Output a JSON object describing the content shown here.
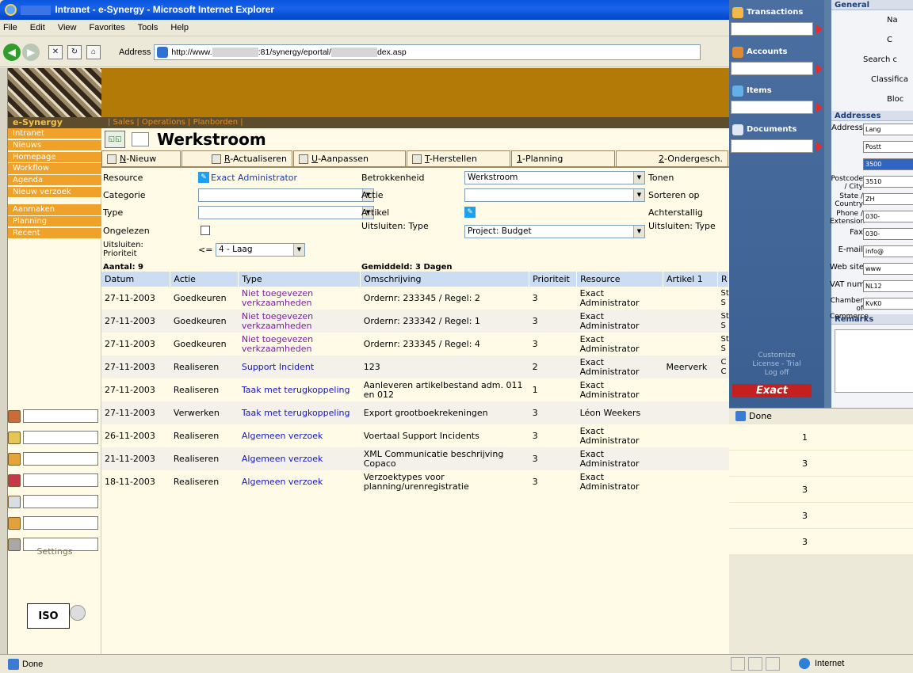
{
  "window": {
    "title": "Intranet - e-Synergy - Microsoft Internet Explorer"
  },
  "menu": [
    "File",
    "Edit",
    "View",
    "Favorites",
    "Tools",
    "Help"
  ],
  "address": {
    "label": "Address",
    "url_start": "http://www.",
    "url_mid": ":81/synergy/eportal/",
    "url_end": "dex.asp"
  },
  "app": {
    "brand": "e-Synergy",
    "top_tabs": "| Sales | Operations | Planborden |",
    "nav": [
      "Intranet",
      "Nieuws",
      "Homepage",
      "Workflow",
      "Agenda",
      "Nieuw verzoek"
    ],
    "nav2": [
      "Aanmaken",
      "Planning",
      "Recent"
    ],
    "settings": "Settings",
    "page_title": "Werkstroom",
    "actions": [
      {
        "key": "N",
        "rest": "-Nieuw"
      },
      {
        "key": "R",
        "rest": "-Actualiseren"
      },
      {
        "key": "U",
        "rest": "-Aanpassen"
      },
      {
        "key": "T",
        "rest": "-Herstellen"
      },
      {
        "key": "1",
        "rest": "-Planning"
      },
      {
        "key": "2",
        "rest": "-Ondergesch."
      }
    ],
    "filters": {
      "resource_label": "Resource",
      "resource_value": "Exact Administrator",
      "categorie_label": "Categorie",
      "type_label": "Type",
      "ongelezen_label": "Ongelezen",
      "uitsluiten_prioriteit_label": "Uitsluiten: Prioriteit",
      "prioriteit_op": "<=",
      "prioriteit_value": "4 - Laag",
      "betrokkenheid_label": "Betrokkenheid",
      "betrokkenheid_value": "Werkstroom",
      "actie_label": "Actie",
      "artikel_label": "Artikel",
      "uitsluiten_type_label": "Uitsluiten: Type",
      "uitsluiten_type_value": "Project: Budget",
      "tonen_label": "Tonen",
      "sorteren_label": "Sorteren op",
      "achterstallig_label": "Achterstallig",
      "uitsluiten_type2_label": "Uitsluiten: Type"
    },
    "summary": {
      "count": "Aantal: 9",
      "avg": "Gemiddeld: 3 Dagen"
    },
    "columns": [
      "Datum",
      "Actie",
      "Type",
      "Omschrijving",
      "Prioriteit",
      "Resource",
      "Artikel 1",
      "R"
    ],
    "rows": [
      {
        "datum": "27-11-2003",
        "actie": "Goedkeuren",
        "type": "Niet toegevezen verkzaamheden",
        "omschrijving": "Ordernr: 233345 / Regel: 2",
        "prioriteit": "3",
        "resource": "Exact Administrator",
        "artikel": "",
        "r": "St S"
      },
      {
        "datum": "27-11-2003",
        "actie": "Goedkeuren",
        "type": "Niet toegevezen verkzaamheden",
        "omschrijving": "Ordernr: 233342 / Regel: 1",
        "prioriteit": "3",
        "resource": "Exact Administrator",
        "artikel": "",
        "r": "St S"
      },
      {
        "datum": "27-11-2003",
        "actie": "Goedkeuren",
        "type": "Niet toegevezen verkzaamheden",
        "omschrijving": "Ordernr: 233345 / Regel: 4",
        "prioriteit": "3",
        "resource": "Exact Administrator",
        "artikel": "",
        "r": "St S"
      },
      {
        "datum": "27-11-2003",
        "actie": "Realiseren",
        "type": "Support Incident",
        "omschrijving": "123",
        "prioriteit": "2",
        "resource": "Exact Administrator",
        "artikel": "Meerverk",
        "r": "C C"
      },
      {
        "datum": "27-11-2003",
        "actie": "Realiseren",
        "type": "Taak met terugkoppeling",
        "omschrijving": "Aanleveren artikelbestand adm. 011 en 012",
        "prioriteit": "1",
        "resource": "Exact Administrator",
        "artikel": "",
        "r": ""
      },
      {
        "datum": "27-11-2003",
        "actie": "Verwerken",
        "type": "Taak met terugkoppeling",
        "omschrijving": "Export grootboekrekeningen",
        "prioriteit": "3",
        "resource": "Léon Weekers",
        "artikel": "",
        "r": ""
      },
      {
        "datum": "26-11-2003",
        "actie": "Realiseren",
        "type": "Algemeen verzoek",
        "omschrijving": "Voertaal Support Incidents",
        "prioriteit": "3",
        "resource": "Exact Administrator",
        "artikel": "",
        "r": ""
      },
      {
        "datum": "21-11-2003",
        "actie": "Realiseren",
        "type": "Algemeen verzoek",
        "omschrijving": "XML Communicatie beschrijving Copaco",
        "prioriteit": "3",
        "resource": "Exact Administrator",
        "artikel": "",
        "r": ""
      },
      {
        "datum": "18-11-2003",
        "actie": "Realiseren",
        "type": "Algemeen verzoek",
        "omschrijving": "Verzoektypes voor planning/urenregistratie",
        "prioriteit": "3",
        "resource": "Exact Administrator",
        "artikel": "",
        "r": ""
      }
    ]
  },
  "overlay": {
    "tabs": [
      "Transactions",
      "Accounts",
      "Items",
      "Documents"
    ],
    "links": [
      "Customize",
      "License - Trial",
      "Log off"
    ],
    "powered": "Exact",
    "general_head": "General",
    "general_fields": [
      "Na",
      "C",
      "Search c",
      "Classifica",
      "Bloc"
    ],
    "addresses_head": "Addresses",
    "address_rows": [
      {
        "label": "Address",
        "value": "Lang"
      },
      {
        "label": "",
        "value": "Postt"
      },
      {
        "label": "",
        "value": "3500"
      },
      {
        "label": "Postcode / City",
        "value": "3510"
      },
      {
        "label": "State / Country",
        "value": "ZH"
      },
      {
        "label": "Phone / Extension",
        "value": "030-"
      },
      {
        "label": "Fax",
        "value": "030-"
      },
      {
        "label": "E-mail",
        "value": "info@"
      },
      {
        "label": "Web site",
        "value": "www"
      },
      {
        "label": "VAT number",
        "value": "NL12"
      },
      {
        "label": "Chamber of Commerce",
        "value": "KvK0"
      }
    ],
    "remarks_head": "Remarks",
    "status": "Done",
    "ghost_values": [
      "1",
      "3",
      "3",
      "3",
      "3"
    ]
  },
  "status": {
    "done": "Done",
    "zone": "Internet"
  }
}
